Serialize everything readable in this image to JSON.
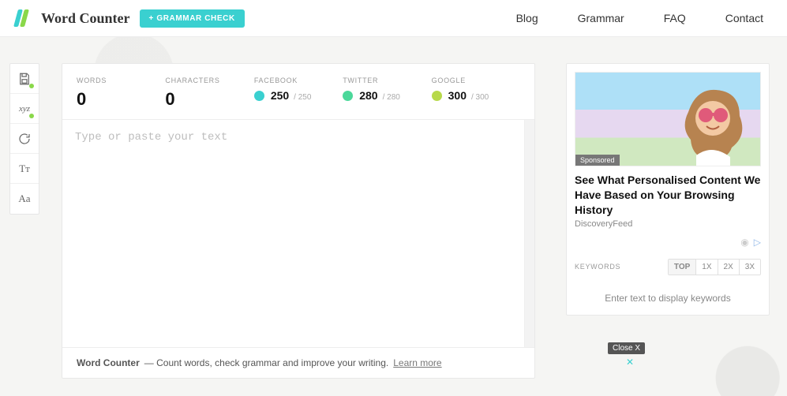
{
  "header": {
    "title": "Word Counter",
    "grammar_button": "+ GRAMMAR CHECK",
    "nav": {
      "blog": "Blog",
      "grammar": "Grammar",
      "faq": "FAQ",
      "contact": "Contact"
    }
  },
  "rail": {
    "save": "save-icon",
    "xyz": "xyz",
    "refresh": "refresh-icon",
    "tt": "Tᴛ",
    "aa": "Aa"
  },
  "stats": {
    "words": {
      "label": "WORDS",
      "value": "0"
    },
    "chars": {
      "label": "CHARACTERS",
      "value": "0"
    },
    "facebook": {
      "label": "FACEBOOK",
      "value": "250",
      "max": "/ 250"
    },
    "twitter": {
      "label": "TWITTER",
      "value": "280",
      "max": "/ 280"
    },
    "google": {
      "label": "GOOGLE",
      "value": "300",
      "max": "/ 300"
    }
  },
  "editor": {
    "placeholder": "Type or paste your text"
  },
  "footer": {
    "strong": "Word Counter",
    "desc": " — Count words, check grammar and improve your writing.",
    "link": "Learn more"
  },
  "sidebar": {
    "ad": {
      "tag": "Sponsored",
      "title": "See What Personalised Content We Have Based on Your Browsing History",
      "source": "DiscoveryFeed"
    },
    "keywords": {
      "label": "KEYWORDS",
      "tabs": {
        "top": "TOP",
        "x1": "1X",
        "x2": "2X",
        "x3": "3X"
      },
      "empty": "Enter text to display keywords"
    }
  },
  "overlay": {
    "close": "Close X"
  }
}
